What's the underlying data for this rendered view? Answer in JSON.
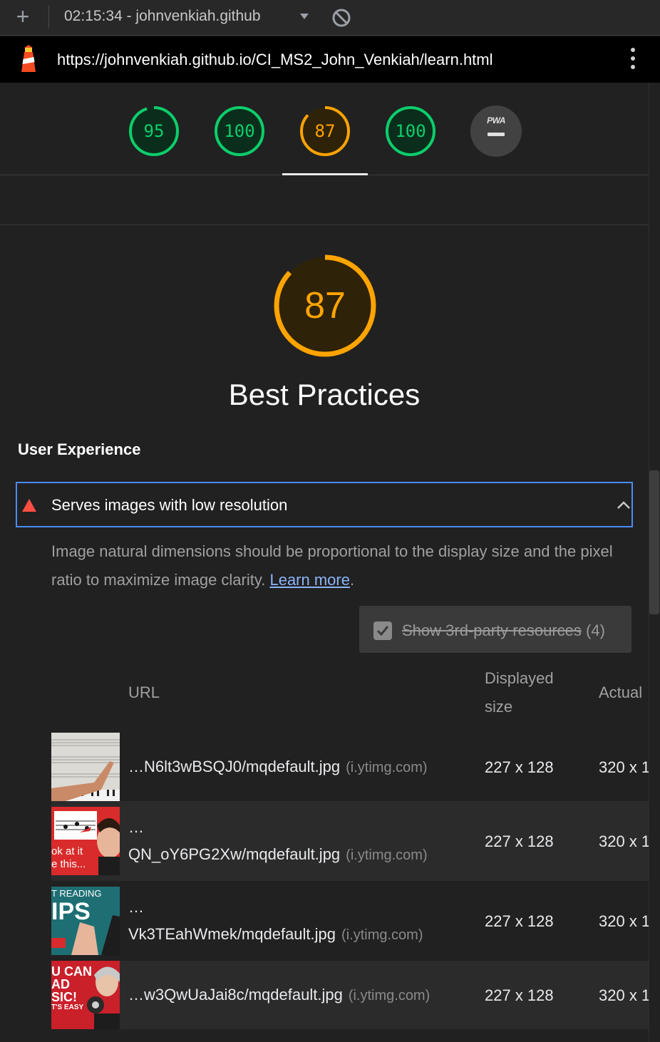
{
  "topbar": {
    "new_report_icon": "plus-icon",
    "report_title": "02:15:34 - johnvenkiah.github",
    "dropdown_icon": "caret-down-icon",
    "clear_icon": "block-icon"
  },
  "urlbar": {
    "logo_icon": "lighthouse-icon",
    "url": "https://johnvenkiah.github.io/CI_MS2_John_Venkiah/learn.html",
    "menu_icon": "kebab-menu-icon"
  },
  "gauges": [
    {
      "score": "95",
      "color": "#0cce6b"
    },
    {
      "score": "100",
      "color": "#0cce6b"
    },
    {
      "score": "87",
      "color": "#ffa400"
    },
    {
      "score": "100",
      "color": "#0cce6b"
    },
    {
      "label": "PWA",
      "value": "—"
    }
  ],
  "category": {
    "score": "87",
    "score_fraction": 0.87,
    "title": "Best Practices",
    "accent": "#ffa400"
  },
  "group": {
    "title": "User Experience"
  },
  "audit": {
    "status_icon": "warning-triangle-icon",
    "title": "Serves images with low resolution",
    "expanded": true,
    "description": "Image natural dimensions should be proportional to the display size and the pixel ratio to maximize image clarity.",
    "learn_more": "Learn more",
    "third_party_label": "Show 3rd-party resources",
    "third_party_count": "(4)",
    "third_party_checked": true
  },
  "table": {
    "headers": {
      "url": "URL",
      "displayed": "Displayed size",
      "displayed_line1": "Displayed",
      "displayed_line2": "size",
      "actual": "Actual"
    },
    "rows": [
      {
        "url_prefix": "",
        "url": "…N6lt3wBSQJ0/mqdefault.jpg",
        "host": "(i.ytimg.com)",
        "displayed": "227 x 128",
        "actual": "320 x 1"
      },
      {
        "url_prefix": "…",
        "url": "QN_oY6PG2Xw/mqdefault.jpg",
        "host": "(i.ytimg.com)",
        "displayed": "227 x 128",
        "actual": "320 x 1"
      },
      {
        "url_prefix": "…",
        "url": "Vk3TEahWmek/mqdefault.jpg",
        "host": "(i.ytimg.com)",
        "displayed": "227 x 128",
        "actual": "320 x 1"
      },
      {
        "url_prefix": "",
        "url": "…w3QwUaJai8c/mqdefault.jpg",
        "host": "(i.ytimg.com)",
        "displayed": "227 x 128",
        "actual": "320 x 1"
      }
    ],
    "thumb_texts": {
      "row2_line1": "ok at it",
      "row2_line2": "e this...",
      "row3_line1": "T READING",
      "row3_line2": "IPS",
      "row4_line1": "U CAN",
      "row4_line2": "AD",
      "row4_line3": "SIC!",
      "row4_line4": "T'S EASY"
    }
  }
}
